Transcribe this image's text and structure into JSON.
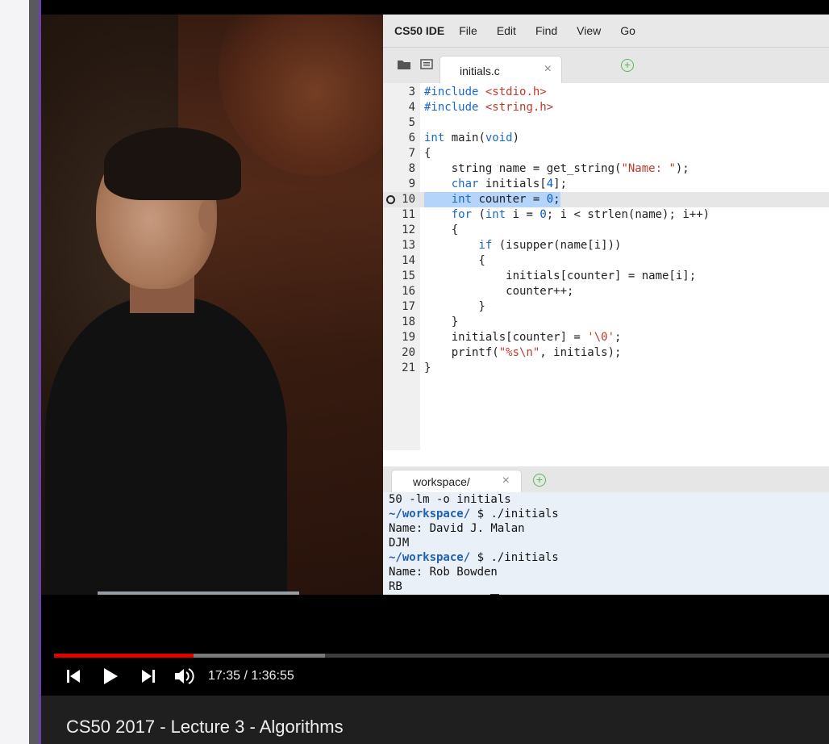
{
  "video": {
    "time_current": "17:35",
    "time_separator": " / ",
    "time_total": "1:36:55",
    "progress_played_fraction": 0.18,
    "progress_buffered_fraction": 0.35,
    "title": "CS50 2017 - Lecture 3 - Algorithms"
  },
  "ide": {
    "menu": [
      "CS50 IDE",
      "File",
      "Edit",
      "Find",
      "View",
      "Go"
    ],
    "editor_tab": {
      "label": "initials.c",
      "close": "×"
    },
    "code_lines": [
      {
        "n": "3"
      },
      {
        "n": "4"
      },
      {
        "n": "5"
      },
      {
        "n": "6"
      },
      {
        "n": "7"
      },
      {
        "n": "8"
      },
      {
        "n": "9"
      },
      {
        "n": "10"
      },
      {
        "n": "11"
      },
      {
        "n": "12"
      },
      {
        "n": "13"
      },
      {
        "n": "14"
      },
      {
        "n": "15"
      },
      {
        "n": "16"
      },
      {
        "n": "17"
      },
      {
        "n": "18"
      },
      {
        "n": "19"
      },
      {
        "n": "20"
      },
      {
        "n": "21"
      }
    ],
    "code_text": [
      "#include <stdio.h>",
      "#include <string.h>",
      "",
      "int main(void)",
      "{",
      "    string name = get_string(\"Name: \");",
      "    char initials[4];",
      "    int counter = 0;",
      "    for (int i = 0; i < strlen(name); i++)",
      "    {",
      "        if (isupper(name[i]))",
      "        {",
      "            initials[counter] = name[i];",
      "            counter++;",
      "        }",
      "    }",
      "    initials[counter] = '\\0';",
      "    printf(\"%s\\n\", initials);",
      "}"
    ],
    "terminal_tab": {
      "label": "workspace/",
      "close": "×"
    },
    "terminal": {
      "line1": "50 -lm -o initials",
      "prompt_path": "~/workspace/",
      "prompt_symbol": " $ ",
      "cmd1": "./initials",
      "out1": "Name: David J. Malan",
      "out2": "DJM",
      "cmd2": "./initials",
      "out3": "Name: Rob Bowden",
      "out4": "RB"
    }
  }
}
